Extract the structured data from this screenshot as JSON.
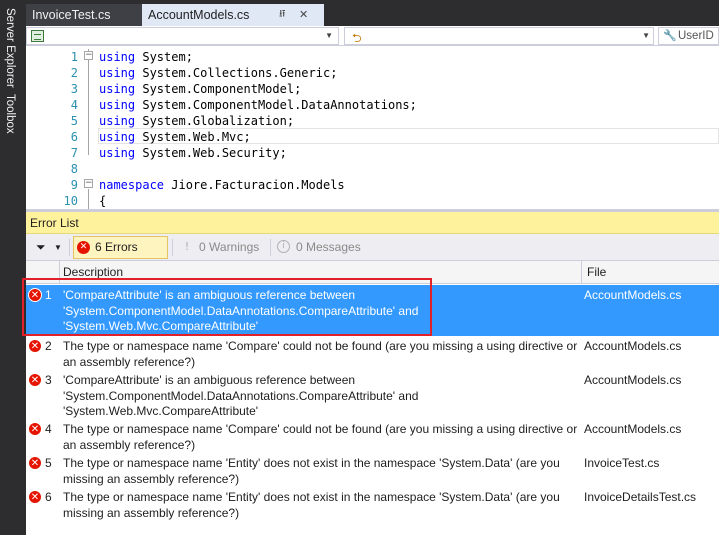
{
  "side_tabs": [
    "Server Explorer",
    "Toolbox"
  ],
  "doc_tabs": [
    {
      "label": "InvoiceTest.cs",
      "active": false
    },
    {
      "label": "AccountModels.cs",
      "active": true
    }
  ],
  "nav_bar": {
    "member_label": "UserID"
  },
  "editor": {
    "lines": [
      {
        "num": "1",
        "kw": "using",
        "text": " System;"
      },
      {
        "num": "2",
        "kw": "using",
        "text": " System.Collections.Generic;"
      },
      {
        "num": "3",
        "kw": "using",
        "text": " System.ComponentModel;"
      },
      {
        "num": "4",
        "kw": "using",
        "text": " System.ComponentModel.DataAnnotations;"
      },
      {
        "num": "5",
        "kw": "using",
        "text": " System.Globalization;"
      },
      {
        "num": "6",
        "kw": "using",
        "text": " System.Web.Mvc;"
      },
      {
        "num": "7",
        "kw": "using",
        "text": " System.Web.Security;"
      },
      {
        "num": "8",
        "kw": "",
        "text": ""
      },
      {
        "num": "9",
        "kw": "namespace",
        "text": " Jiore.Facturacion.Models"
      },
      {
        "num": "10",
        "kw": "",
        "text": "{"
      }
    ]
  },
  "error_list": {
    "title": "Error List",
    "errors_label": "6 Errors",
    "warnings_label": "0 Warnings",
    "messages_label": "0 Messages",
    "columns": {
      "description": "Description",
      "file": "File"
    },
    "rows": [
      {
        "num": "1",
        "description": "'CompareAttribute' is an ambiguous reference between 'System.ComponentModel.DataAnnotations.CompareAttribute' and 'System.Web.Mvc.CompareAttribute'",
        "file": "AccountModels.cs",
        "selected": true
      },
      {
        "num": "2",
        "description": "The type or namespace name 'Compare' could not be found (are you missing a using directive or an assembly reference?)",
        "file": "AccountModels.cs",
        "selected": false
      },
      {
        "num": "3",
        "description": "'CompareAttribute' is an ambiguous reference between 'System.ComponentModel.DataAnnotations.CompareAttribute' and 'System.Web.Mvc.CompareAttribute'",
        "file": "AccountModels.cs",
        "selected": false
      },
      {
        "num": "4",
        "description": "The type or namespace name 'Compare' could not be found (are you missing a using directive or an assembly reference?)",
        "file": "AccountModels.cs",
        "selected": false
      },
      {
        "num": "5",
        "description": "The type or namespace name 'Entity' does not exist in the namespace 'System.Data' (are you missing an assembly reference?)",
        "file": "InvoiceTest.cs",
        "selected": false
      },
      {
        "num": "6",
        "description": "The type or namespace name 'Entity' does not exist in the namespace 'System.Data' (are you missing an assembly reference?)",
        "file": "InvoiceDetailsTest.cs",
        "selected": false
      }
    ]
  },
  "icons": {
    "error": "error-circle-icon",
    "warning": "warning-triangle-icon",
    "message": "info-circle-icon",
    "filter": "funnel-icon"
  },
  "colors": {
    "selection": "#3399ff",
    "error_red": "#e51400",
    "title_yellow": "#fff29d",
    "keyword_blue": "#0000ff",
    "line_number": "#2b91af"
  }
}
